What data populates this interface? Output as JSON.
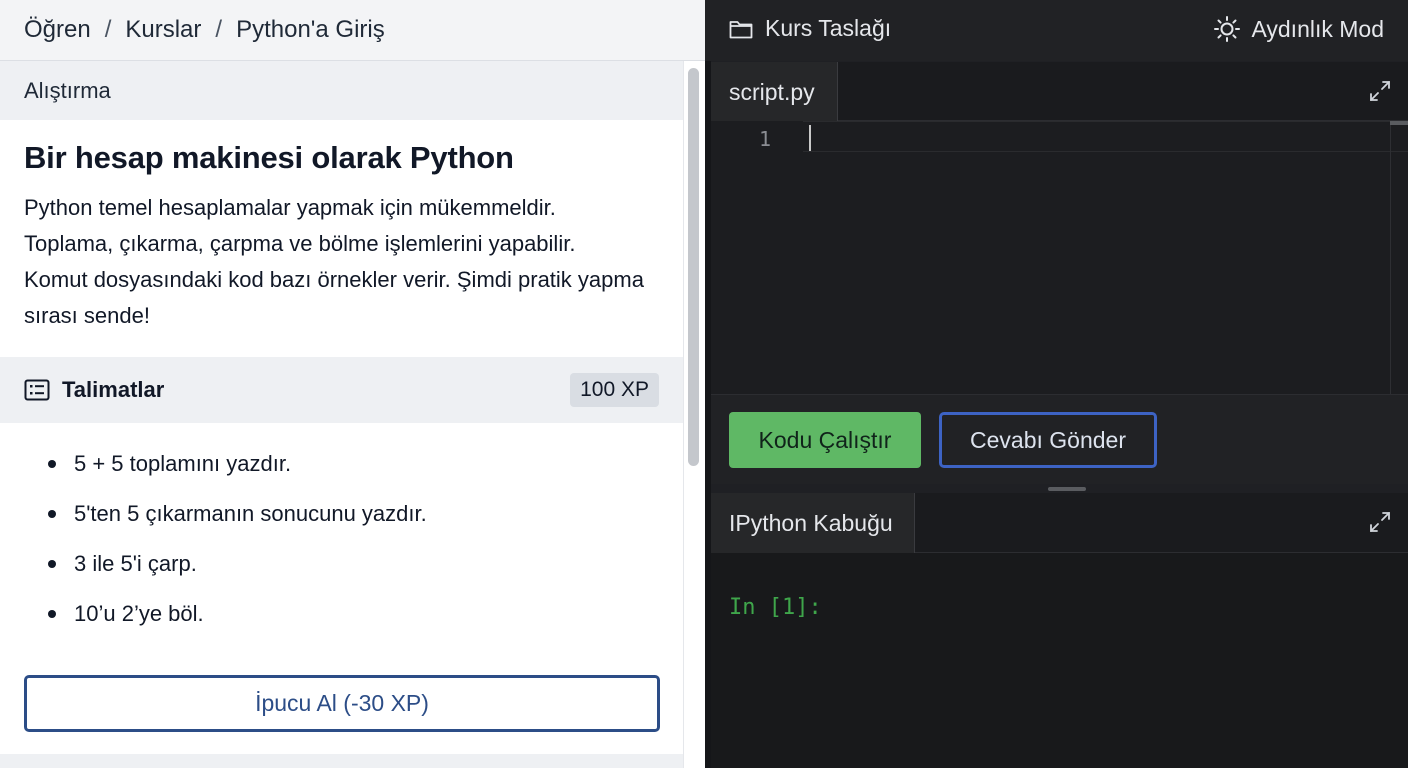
{
  "breadcrumb": {
    "items": [
      "Öğren",
      "Kurslar",
      "Python'a Giriş"
    ],
    "separator": "/"
  },
  "exercise": {
    "section_label": "Alıştırma",
    "title": "Bir hesap makinesi olarak Python",
    "description": "Python temel hesaplamalar yapmak için mükemmeldir. Toplama, çıkarma, çarpma ve bölme işlemlerini yapabilir. Komut dosyasındaki kod bazı örnekler verir. Şimdi pratik yapma sırası sende!"
  },
  "instructions": {
    "icon": "list-icon",
    "title": "Talimatlar",
    "xp": "100 XP",
    "items": [
      "5 + 5 toplamını yazdır.",
      "5'ten 5 çıkarmanın sonucunu yazdır.",
      "3 ile 5'i çarp.",
      "10’u 2’ye böl."
    ],
    "hint_button": "İpucu Al (-30 XP)"
  },
  "topbar": {
    "course_outline": "Kurs Taslağı",
    "course_outline_icon": "folder-icon",
    "light_mode": "Aydınlık Mod",
    "light_mode_icon": "sun-icon"
  },
  "editor": {
    "tab": "script.py",
    "line_numbers": [
      "1"
    ],
    "expand_icon": "expand-icon"
  },
  "actions": {
    "run": "Kodu Çalıştır",
    "submit": "Cevabı Gönder"
  },
  "shell": {
    "tab": "IPython Kabuğu",
    "prompt": "In [1]:",
    "expand_icon": "expand-icon"
  },
  "colors": {
    "run_button": "#5fb865",
    "submit_border": "#3d63c4",
    "hint_border": "#2c4d87",
    "prompt_green": "#3fa64b",
    "dark_bg": "#1f2024"
  }
}
